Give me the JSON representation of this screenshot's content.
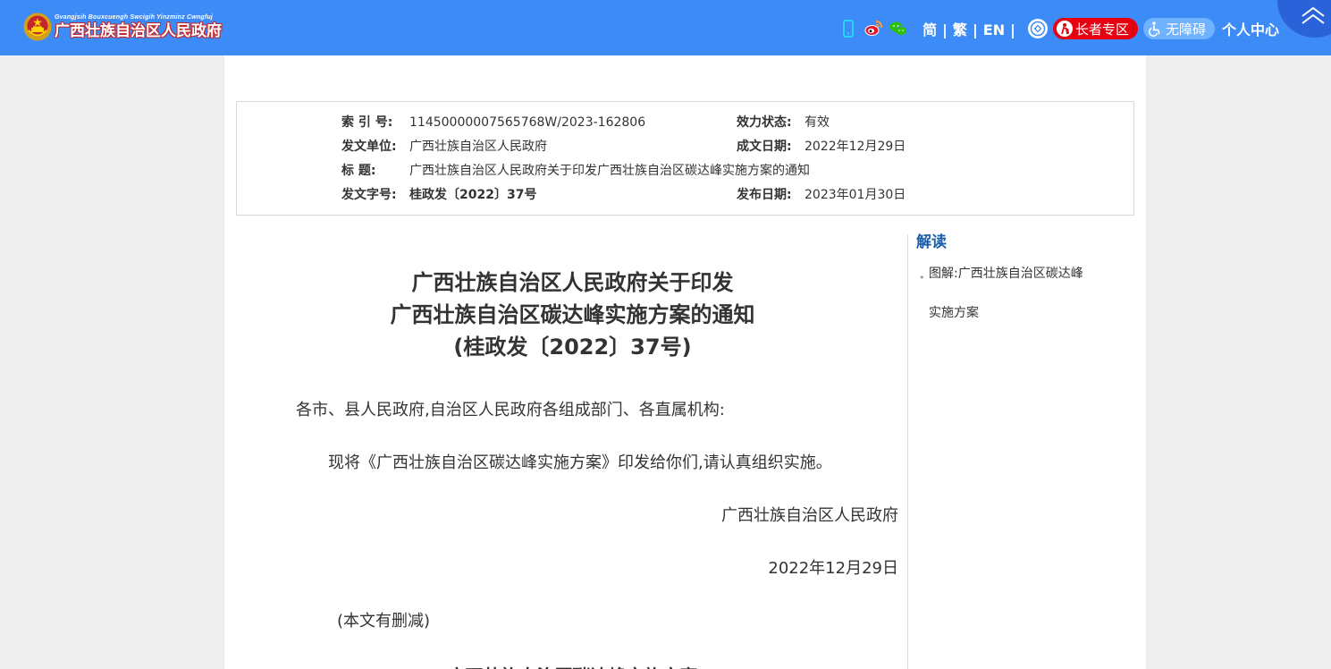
{
  "header": {
    "logo_subtitle": "Gvangjsih Bouxcuengh Swcigih Yinzminz Cwngfuj",
    "logo_title": "广西壮族自治区人民政府",
    "lang_simplified": "简",
    "lang_traditional": "繁",
    "lang_english": "EN",
    "separator": "|",
    "elder_label": "长者专区",
    "accessibility_label": "无障碍",
    "personal_center": "个人中心",
    "accent_color": "#3d8bf7",
    "icons": [
      "mobile-icon",
      "weibo-icon",
      "wechat-icon",
      "service-icon",
      "elder-icon",
      "wheelchair-icon",
      "chevron-up-icon"
    ]
  },
  "info": {
    "index_label": "索 引 号:",
    "index_value": "11450000007565768W/2023-162806",
    "validity_label": "效力状态:",
    "validity_value": "有效",
    "issuer_label": "发文单位:",
    "issuer_value": "广西壮族自治区人民政府",
    "written_date_label": "成文日期:",
    "written_date_value": "2022年12月29日",
    "title_label": "标 题:",
    "title_value": "广西壮族自治区人民政府关于印发广西壮族自治区碳达峰实施方案的通知",
    "doc_no_label": "发文字号:",
    "doc_no_value": "桂政发〔2022〕37号",
    "publish_date_label": "发布日期:",
    "publish_date_value": "2023年01月30日"
  },
  "article": {
    "title_line1": "广西壮族自治区人民政府关于印发",
    "title_line2": "广西壮族自治区碳达峰实施方案的通知",
    "title_line3": "(桂政发〔2022〕37号)",
    "salutation": "各市、县人民政府,自治区人民政府各组成部门、各直属机构:",
    "body": "现将《广西壮族自治区碳达峰实施方案》印发给你们,请认真组织实施。",
    "signature": "广西壮族自治区人民政府",
    "date": "2022年12月29日",
    "note": "(本文有删减)",
    "next_heading": "广西壮族自治区碳达峰实施方案"
  },
  "sidebar": {
    "heading": "解读",
    "link_line1": "图解:广西壮族自治区碳达峰",
    "link_line2": "实施方案"
  }
}
